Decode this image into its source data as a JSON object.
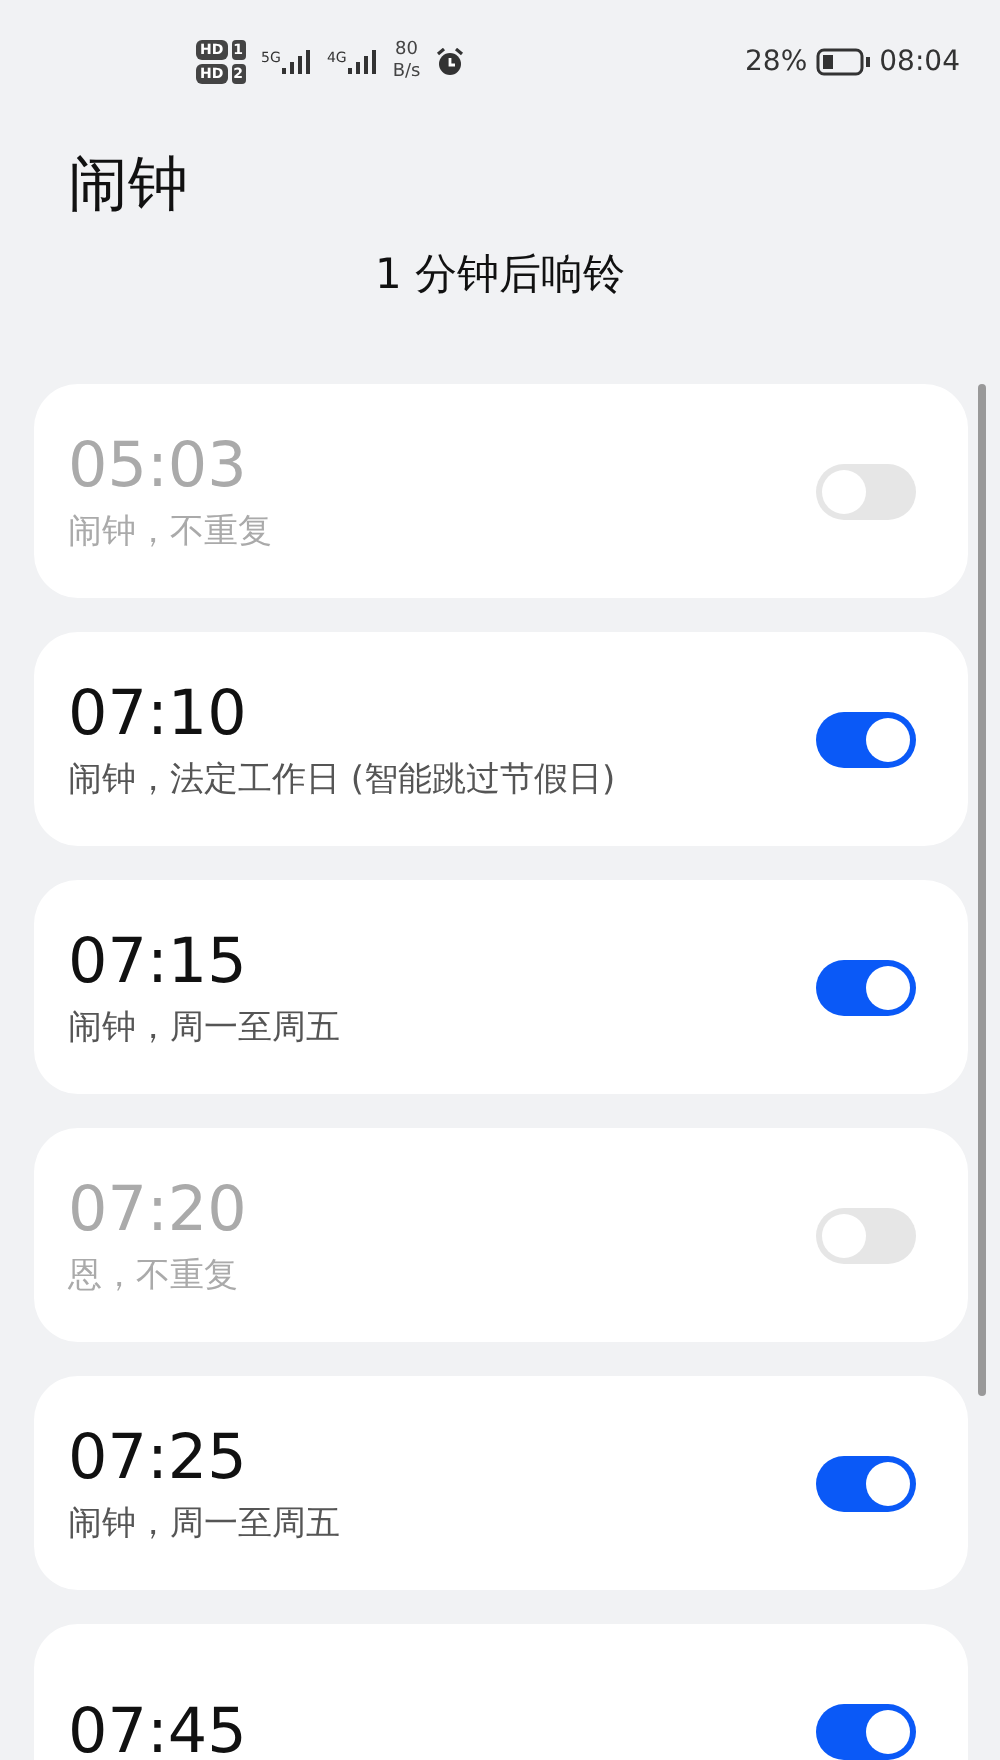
{
  "status_bar": {
    "sims": [
      {
        "badge": "HD",
        "slot": "1"
      },
      {
        "badge": "HD",
        "slot": "2"
      }
    ],
    "networks": [
      "5G",
      "4G"
    ],
    "speed_value": "80",
    "speed_unit": "B/s",
    "battery": "28%",
    "time": "08:04"
  },
  "title": "闹钟",
  "subtitle": "1 分钟后响铃",
  "alarms": [
    {
      "time": "05:03",
      "label": "闹钟，不重复",
      "on": false
    },
    {
      "time": "07:10",
      "label": "闹钟，法定工作日 (智能跳过节假日)",
      "on": true
    },
    {
      "time": "07:15",
      "label": "闹钟，周一至周五",
      "on": true
    },
    {
      "time": "07:20",
      "label": "恩，不重复",
      "on": false
    },
    {
      "time": "07:25",
      "label": "闹钟，周一至周五",
      "on": true
    },
    {
      "time": "07:45",
      "on": true
    }
  ]
}
